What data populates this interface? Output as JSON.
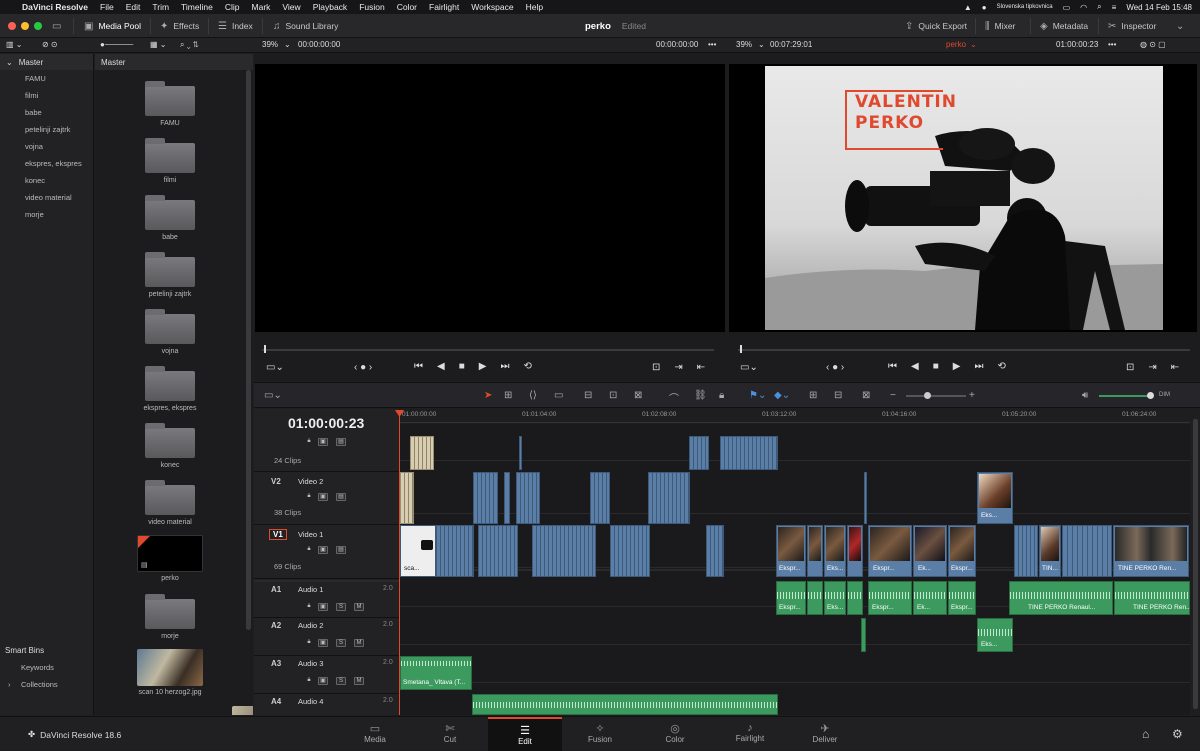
{
  "menubar": {
    "apple": "",
    "app": "DaVinci Resolve",
    "items": [
      "File",
      "Edit",
      "Trim",
      "Timeline",
      "Clip",
      "Mark",
      "View",
      "Playback",
      "Fusion",
      "Color",
      "Fairlight",
      "Workspace",
      "Help"
    ],
    "keyboard": "Slovenska tipkovnica",
    "datetime": "Wed 14 Feb  15:48"
  },
  "toolbar": {
    "media_pool": "Media Pool",
    "effects": "Effects",
    "index": "Index",
    "sound_library": "Sound Library",
    "project": "perko",
    "status": "Edited",
    "quick_export": "Quick Export",
    "mixer": "Mixer",
    "metadata": "Metadata",
    "inspector": "Inspector"
  },
  "subbar": {
    "zoom_left": "39%",
    "tc_left": "00:00:00:00",
    "tc_src_end": "00:00:00:00",
    "zoom_right": "39%",
    "duration": "00:07:29:01",
    "timeline_name": "perko",
    "tc_right": "01:00:00:23"
  },
  "bins": {
    "header": "Master",
    "items": [
      "FAMU",
      "filmi",
      "babe",
      "petelinji zajtrk",
      "vojna",
      "ekspres, ekspres",
      "konec",
      "video material",
      "morje"
    ]
  },
  "smart_bins": {
    "title": "Smart Bins",
    "items": [
      "Keywords",
      "Collections"
    ]
  },
  "pool": {
    "header": "Master",
    "items": [
      {
        "label": "FAMU",
        "kind": "folder"
      },
      {
        "label": "filmi",
        "kind": "folder"
      },
      {
        "label": "babe",
        "kind": "folder"
      },
      {
        "label": "petelinji zajtrk",
        "kind": "folder"
      },
      {
        "label": "vojna",
        "kind": "folder"
      },
      {
        "label": "ekspres, ekspres",
        "kind": "folder"
      },
      {
        "label": "konec",
        "kind": "folder"
      },
      {
        "label": "video material",
        "kind": "folder"
      },
      {
        "label": "perko",
        "kind": "timeline"
      },
      {
        "label": "morje",
        "kind": "folder"
      },
      {
        "label": "scan 10 herzog2.jpg",
        "kind": "image"
      }
    ]
  },
  "viewer": {
    "title_line1": "VALENTIN",
    "title_line2": "PERKO"
  },
  "timeline": {
    "timecode": "01:00:00:23",
    "ruler": [
      "01:00:00:00",
      "01:01:04:00",
      "01:02:08:00",
      "01:03:12:00",
      "01:04:16:00",
      "01:05:20:00",
      "01:06:24:00"
    ],
    "tracks": [
      {
        "id": "",
        "name": "",
        "count": "24 Clips"
      },
      {
        "id": "V2",
        "name": "Video 2",
        "count": "38 Clips"
      },
      {
        "id": "V1",
        "name": "Video 1",
        "count": "69 Clips"
      },
      {
        "id": "A1",
        "name": "Audio 1",
        "vol": "2.0"
      },
      {
        "id": "A2",
        "name": "Audio 2",
        "vol": "2.0"
      },
      {
        "id": "A3",
        "name": "Audio 3",
        "vol": "2.0"
      },
      {
        "id": "A4",
        "name": "Audio 4",
        "vol": "2.0"
      }
    ],
    "clip_labels": {
      "sca": "sca...",
      "eks": "Eks...",
      "ekspr": "Ekspr...",
      "ek": "Ek...",
      "tin": "TIN...",
      "tine": "TINE PERKO Ren...",
      "tine_audio": "TINE PERKO Renaul...",
      "smetana": "Smetana_ Vltava (T...",
      "a_eks": "Eks..."
    },
    "mute": "M",
    "solo": "S",
    "dim": "DIM"
  },
  "pages": [
    "Media",
    "Cut",
    "Edit",
    "Fusion",
    "Color",
    "Fairlight",
    "Deliver"
  ],
  "active_page": "Edit",
  "brand": "DaVinci Resolve 18.6",
  "accent": "#e0492e"
}
